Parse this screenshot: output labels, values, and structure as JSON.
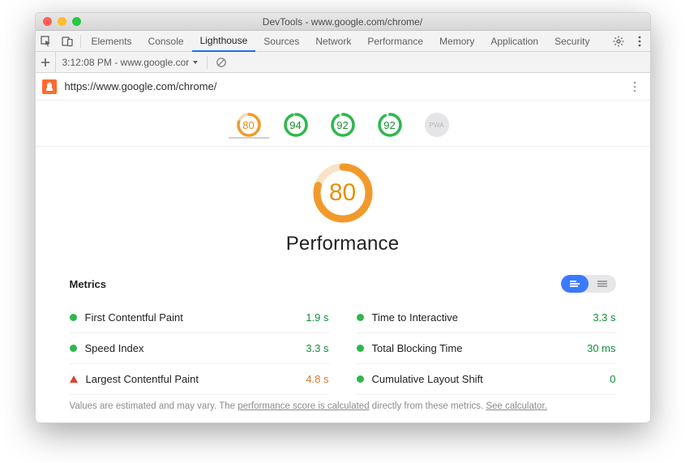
{
  "window": {
    "title": "DevTools - www.google.com/chrome/"
  },
  "tabs": {
    "elements": "Elements",
    "console": "Console",
    "lighthouse": "Lighthouse",
    "sources": "Sources",
    "network": "Network",
    "performance": "Performance",
    "memory": "Memory",
    "application": "Application",
    "security": "Security"
  },
  "toolbar2": {
    "timestamp_page": "3:12:08 PM - www.google.cor"
  },
  "url": "https://www.google.com/chrome/",
  "nav_scores": {
    "performance": "80",
    "accessibility": "94",
    "best_practices": "92",
    "seo": "92",
    "pwa": "PWA"
  },
  "main": {
    "score": "80",
    "heading": "Performance"
  },
  "metrics": {
    "title": "Metrics",
    "items": [
      {
        "label": "First Contentful Paint",
        "value": "1.9 s",
        "status": "green",
        "value_color": "green"
      },
      {
        "label": "Time to Interactive",
        "value": "3.3 s",
        "status": "green",
        "value_color": "green"
      },
      {
        "label": "Speed Index",
        "value": "3.3 s",
        "status": "green",
        "value_color": "green"
      },
      {
        "label": "Total Blocking Time",
        "value": "30 ms",
        "status": "green",
        "value_color": "green"
      },
      {
        "label": "Largest Contentful Paint",
        "value": "4.8 s",
        "status": "red",
        "value_color": "orange"
      },
      {
        "label": "Cumulative Layout Shift",
        "value": "0",
        "status": "green",
        "value_color": "green"
      }
    ]
  },
  "footnote": {
    "a": "Values are estimated and may vary. The ",
    "b": "performance score is calculated",
    "c": " directly from these metrics. ",
    "d": "See calculator."
  }
}
